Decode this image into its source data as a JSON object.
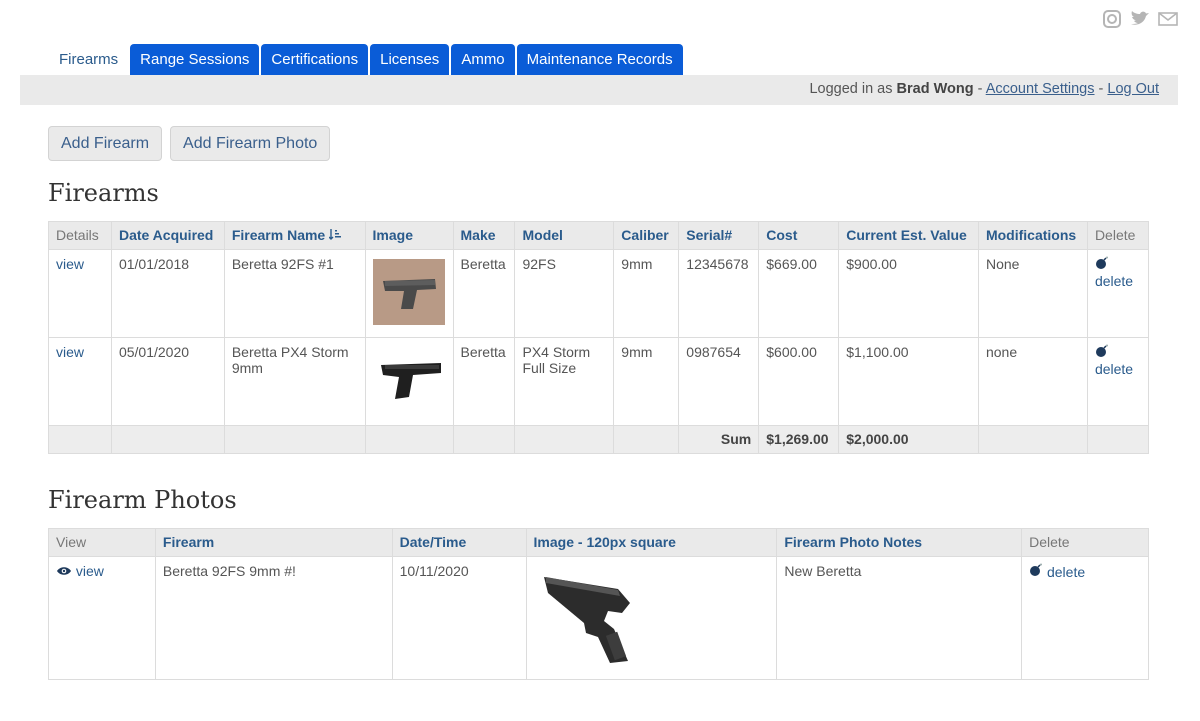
{
  "social": {
    "icons": [
      "instagram-icon",
      "twitter-icon",
      "mail-icon"
    ]
  },
  "tabs": [
    {
      "label": "Firearms",
      "active": true
    },
    {
      "label": "Range Sessions"
    },
    {
      "label": "Certifications"
    },
    {
      "label": "Licenses"
    },
    {
      "label": "Ammo"
    },
    {
      "label": "Maintenance Records"
    }
  ],
  "userbar": {
    "prefix": "Logged in as ",
    "username": "Brad Wong",
    "sep1": " - ",
    "account_settings": "Account Settings",
    "sep2": " - ",
    "logout": "Log Out"
  },
  "actions": {
    "add_firearm": "Add Firearm",
    "add_photo": "Add Firearm Photo"
  },
  "firearms": {
    "title": "Firearms",
    "headers": [
      "Details",
      "Date Acquired",
      "Firearm Name",
      "Image",
      "Make",
      "Model",
      "Caliber",
      "Serial#",
      "Cost",
      "Current Est. Value",
      "Modifications",
      "Delete"
    ],
    "sort_icon": "sort-ascending-icon",
    "rows": [
      {
        "details": "view",
        "date": "01/01/2018",
        "name": "Beretta 92FS #1",
        "make": "Beretta",
        "model": "92FS",
        "caliber": "9mm",
        "serial": "12345678",
        "cost": "$669.00",
        "value": "$900.00",
        "mods": "None",
        "delete": "delete"
      },
      {
        "details": "view",
        "date": "05/01/2020",
        "name": "Beretta PX4 Storm 9mm",
        "make": "Beretta",
        "model": "PX4 Storm Full Size",
        "caliber": "9mm",
        "serial": "0987654",
        "cost": "$600.00",
        "value": "$1,100.00",
        "mods": "none",
        "delete": "delete"
      }
    ],
    "sum": {
      "label": "Sum",
      "cost": "$1,269.00",
      "value": "$2,000.00"
    }
  },
  "photos": {
    "title": "Firearm Photos",
    "headers": [
      "View",
      "Firearm",
      "Date/Time",
      "Image - 120px square",
      "Firearm Photo Notes",
      "Delete"
    ],
    "rows": [
      {
        "view": "view",
        "firearm": "Beretta 92FS 9mm #!",
        "datetime": "10/11/2020",
        "notes": "New Beretta",
        "delete": "delete"
      }
    ]
  },
  "colors": {
    "accent": "#0a5cd7",
    "link": "#2a5b8c",
    "bar": "#eaeaea"
  }
}
